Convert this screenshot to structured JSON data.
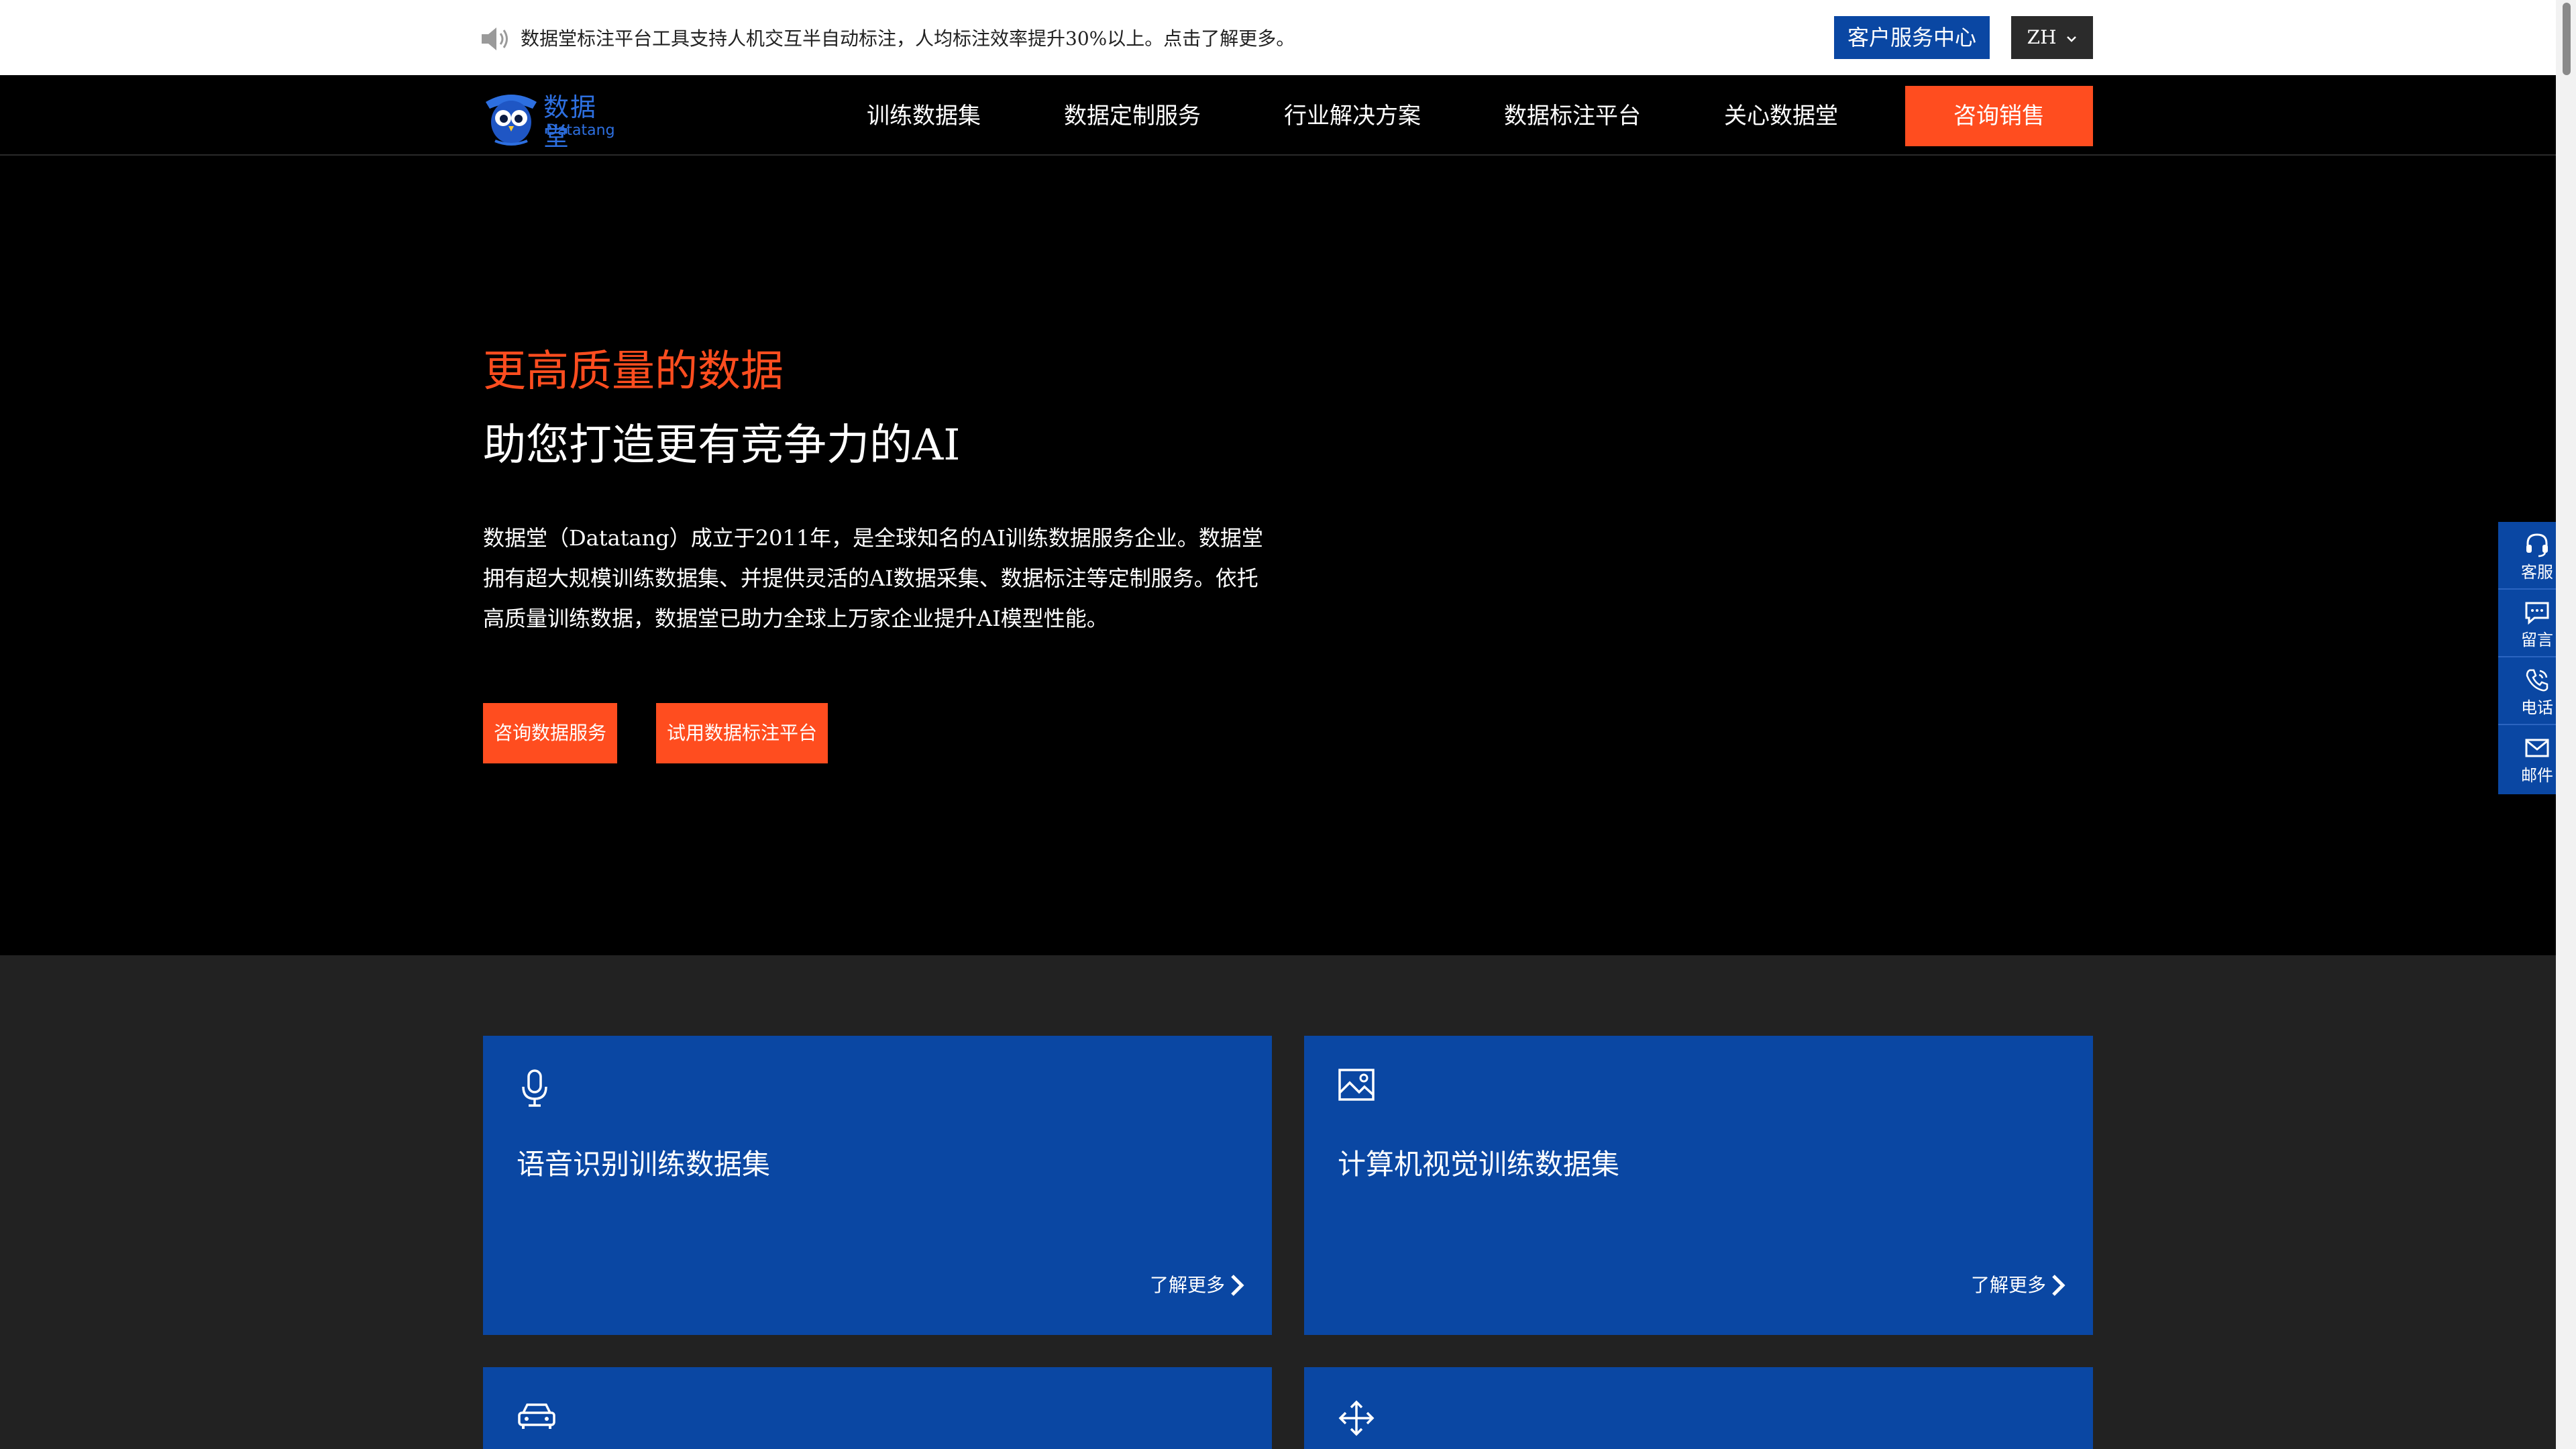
{
  "topbar": {
    "notice": "数据堂标注平台工具支持人机交互半自动标注，人均标注效率提升30%以上。点击了解更多。",
    "service_center": "客户服务中心",
    "lang": "ZH"
  },
  "nav": {
    "logo_cn": "数据堂",
    "logo_en": "Datatang",
    "items": [
      "训练数据集",
      "数据定制服务",
      "行业解决方案",
      "数据标注平台",
      "关心数据堂"
    ],
    "cta": "咨询销售"
  },
  "hero": {
    "title_accent": "更高质量的数据",
    "title_main": "助您打造更有竞争力的AI",
    "description": "数据堂（Datatang）成立于2011年，是全球知名的AI训练数据服务企业。数据堂拥有超大规模训练数据集、并提供灵活的AI数据采集、数据标注等定制服务。依托高质量训练数据，数据堂已助力全球上万家企业提升AI模型性能。",
    "btn_consult": "咨询数据服务",
    "btn_trial": "试用数据标注平台"
  },
  "float_toolbar": {
    "items": [
      {
        "label": "客服",
        "icon": "headset-icon"
      },
      {
        "label": "留言",
        "icon": "message-icon"
      },
      {
        "label": "电话",
        "icon": "phone-icon"
      },
      {
        "label": "邮件",
        "icon": "mail-icon"
      }
    ]
  },
  "cards": [
    {
      "title": "语音识别训练数据集",
      "more": "了解更多",
      "icon": "microphone-icon"
    },
    {
      "title": "计算机视觉训练数据集",
      "more": "了解更多",
      "icon": "image-icon"
    },
    {
      "title": "",
      "more": "",
      "icon": "car-icon"
    },
    {
      "title": "",
      "more": "",
      "icon": "move-icon"
    }
  ],
  "colors": {
    "accent": "#ff4d1f",
    "brand_blue": "#0a47a3",
    "hero_bg": "#000000",
    "section_bg": "#222222"
  }
}
